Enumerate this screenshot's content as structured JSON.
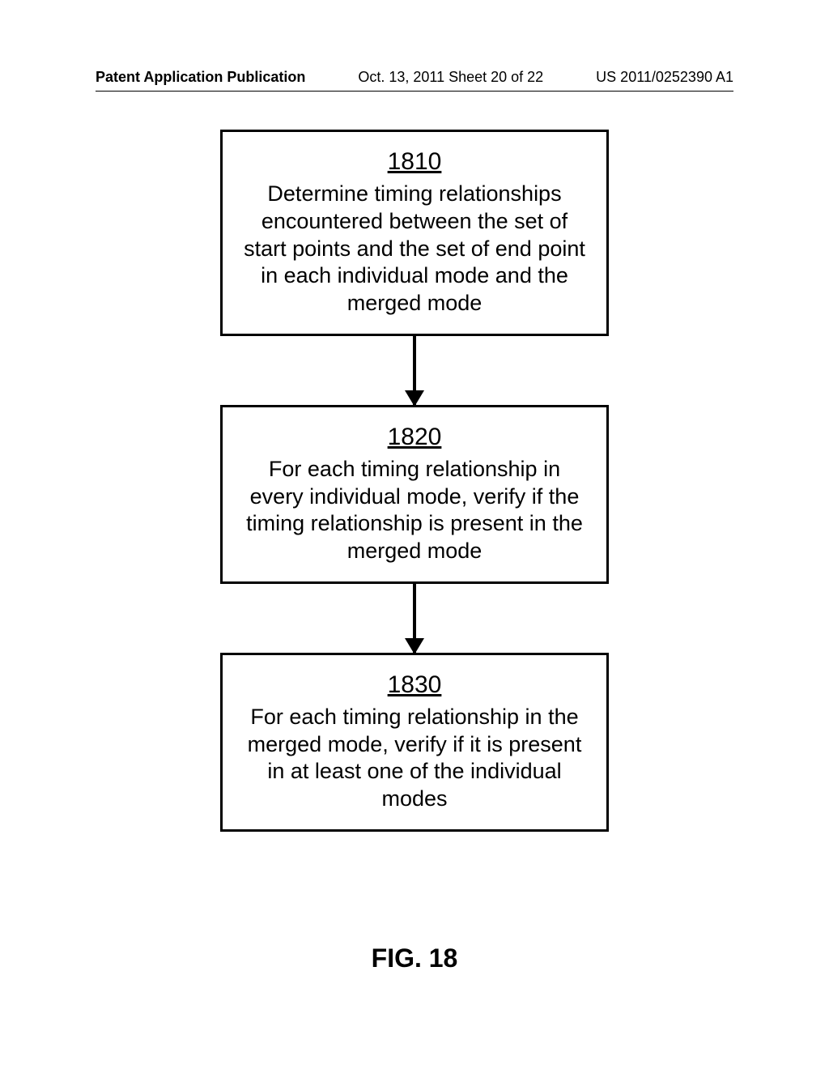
{
  "header": {
    "left": "Patent Application Publication",
    "center": "Oct. 13, 2011   Sheet 20 of 22",
    "right": "US 2011/0252390 A1"
  },
  "boxes": [
    {
      "number": "1810",
      "text": "Determine timing relationships encountered between the set of start points and the set of end point in each individual mode and the merged mode"
    },
    {
      "number": "1820",
      "text": "For each timing relationship in every individual mode, verify if the timing relationship is present in the merged mode"
    },
    {
      "number": "1830",
      "text": "For each timing relationship in the merged mode, verify if it is present in at least one of the individual modes"
    }
  ],
  "figure_label": "FIG. 18"
}
